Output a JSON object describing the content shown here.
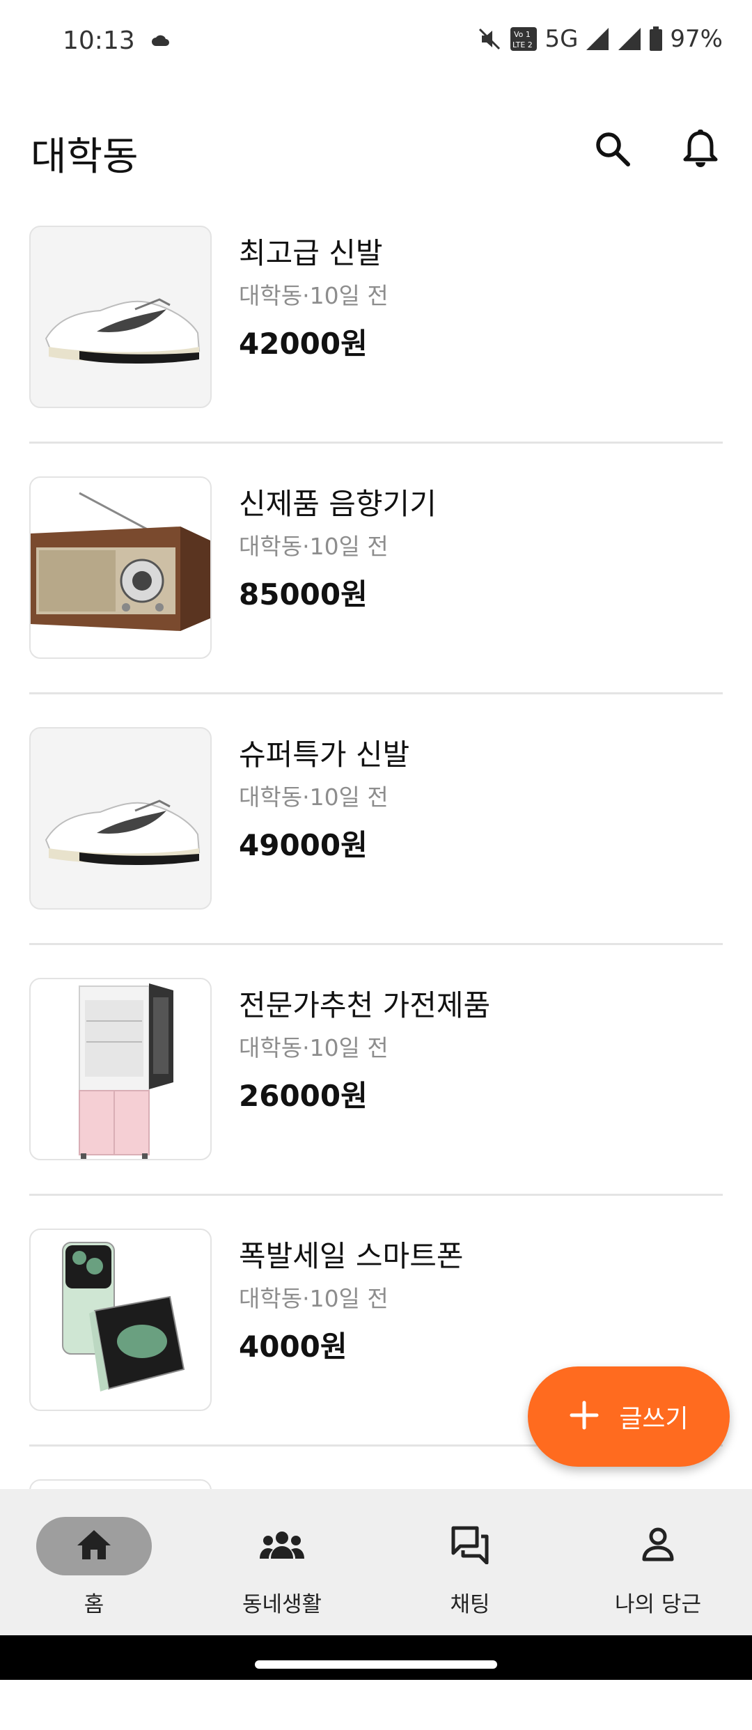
{
  "status_bar": {
    "time": "10:13",
    "network": "5G",
    "battery": "97%"
  },
  "app_bar": {
    "title": "대학동",
    "icons": [
      "search-icon",
      "bell-icon"
    ]
  },
  "items": [
    {
      "title": "최고급 신발",
      "location": "대학동",
      "time": "10일 전",
      "meta": "대학동·10일 전",
      "price": "42000원",
      "image": "sneaker"
    },
    {
      "title": "신제품 음향기기",
      "location": "대학동",
      "time": "10일 전",
      "meta": "대학동·10일 전",
      "price": "85000원",
      "image": "radio"
    },
    {
      "title": "슈퍼특가 신발",
      "location": "대학동",
      "time": "10일 전",
      "meta": "대학동·10일 전",
      "price": "49000원",
      "image": "sneaker"
    },
    {
      "title": "전문가추천 가전제품",
      "location": "대학동",
      "time": "10일 전",
      "meta": "대학동·10일 전",
      "price": "26000원",
      "image": "refrigerator"
    },
    {
      "title": "폭발세일 스마트폰",
      "location": "대학동",
      "time": "10일 전",
      "meta": "대학동·10일 전",
      "price": "4000원",
      "image": "flip-phone"
    }
  ],
  "fab": {
    "label": "글쓰기",
    "icon": "plus-icon",
    "color": "#ff6b1f"
  },
  "bottom_nav": [
    {
      "label": "홈",
      "icon": "home-icon",
      "active": true
    },
    {
      "label": "동네생활",
      "icon": "people-icon",
      "active": false
    },
    {
      "label": "채팅",
      "icon": "chat-icon",
      "active": false
    },
    {
      "label": "나의 당근",
      "icon": "person-icon",
      "active": false
    }
  ]
}
